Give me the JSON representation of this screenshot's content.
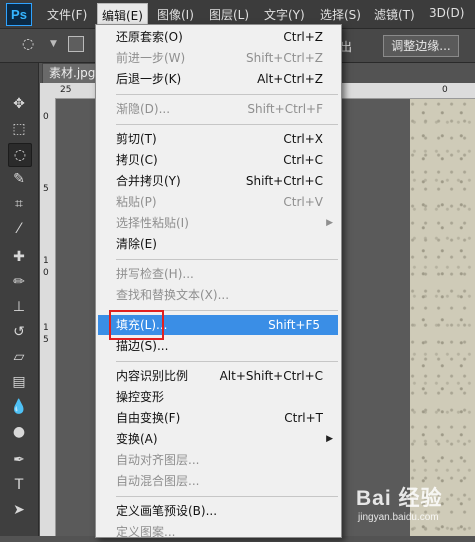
{
  "app": {
    "logo": "Ps"
  },
  "menubar": {
    "items": [
      {
        "label": "文件(F)"
      },
      {
        "label": "编辑(E)"
      },
      {
        "label": "图像(I)"
      },
      {
        "label": "图层(L)"
      },
      {
        "label": "文字(Y)"
      },
      {
        "label": "选择(S)"
      },
      {
        "label": "滤镜(T)"
      },
      {
        "label": "3D(D)"
      }
    ]
  },
  "options": {
    "partial_label": "出",
    "adjust_edge": "调整边缘..."
  },
  "document": {
    "tab": "素材.jpg"
  },
  "rulers": {
    "top_ticks": [
      "25",
      "0"
    ],
    "left_ticks": [
      "0",
      "5",
      "1",
      "0",
      "1",
      "5"
    ]
  },
  "edit_menu": {
    "items": [
      {
        "label": "还原套索(O)",
        "shortcut": "Ctrl+Z",
        "disabled": false
      },
      {
        "label": "前进一步(W)",
        "shortcut": "Shift+Ctrl+Z",
        "disabled": true
      },
      {
        "label": "后退一步(K)",
        "shortcut": "Alt+Ctrl+Z",
        "disabled": false
      },
      {
        "label": "渐隐(D)...",
        "shortcut": "Shift+Ctrl+F",
        "disabled": true
      },
      {
        "label": "剪切(T)",
        "shortcut": "Ctrl+X",
        "disabled": false
      },
      {
        "label": "拷贝(C)",
        "shortcut": "Ctrl+C",
        "disabled": false
      },
      {
        "label": "合并拷贝(Y)",
        "shortcut": "Shift+Ctrl+C",
        "disabled": false
      },
      {
        "label": "粘贴(P)",
        "shortcut": "Ctrl+V",
        "disabled": true
      },
      {
        "label": "选择性粘贴(I)",
        "shortcut": "",
        "disabled": true,
        "submenu": true
      },
      {
        "label": "清除(E)",
        "shortcut": "",
        "disabled": false
      },
      {
        "label": "拼写检查(H)...",
        "shortcut": "",
        "disabled": true
      },
      {
        "label": "查找和替换文本(X)...",
        "shortcut": "",
        "disabled": true
      },
      {
        "label": "填充(L)...",
        "shortcut": "Shift+F5",
        "disabled": false,
        "highlighted": true
      },
      {
        "label": "描边(S)...",
        "shortcut": "",
        "disabled": false
      },
      {
        "label": "内容识别比例",
        "shortcut": "Alt+Shift+Ctrl+C",
        "disabled": false
      },
      {
        "label": "操控变形",
        "shortcut": "",
        "disabled": false
      },
      {
        "label": "自由变换(F)",
        "shortcut": "Ctrl+T",
        "disabled": false
      },
      {
        "label": "变换(A)",
        "shortcut": "",
        "disabled": false,
        "submenu": true
      },
      {
        "label": "自动对齐图层...",
        "shortcut": "",
        "disabled": true
      },
      {
        "label": "自动混合图层...",
        "shortcut": "",
        "disabled": true
      },
      {
        "label": "定义画笔预设(B)...",
        "shortcut": "",
        "disabled": false
      },
      {
        "label": "定义图案...",
        "shortcut": "",
        "disabled": true
      }
    ]
  },
  "watermark": {
    "logo": "Bai 经验",
    "url": "jingyan.baidu.com"
  },
  "colors": {
    "highlight": "#3a8ee6",
    "annotation": "#e02020"
  }
}
